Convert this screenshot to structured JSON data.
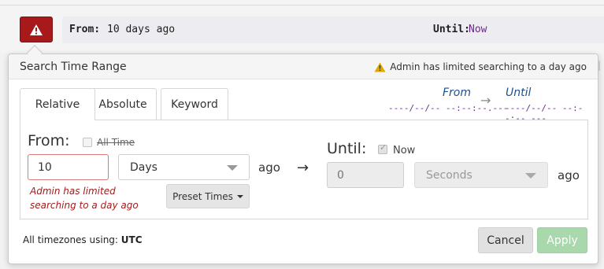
{
  "summary": {
    "from_label": "From:",
    "from_value": "10 days ago",
    "until_label": "Until:",
    "until_value": "Now",
    "warning_icon": "warning-triangle-icon"
  },
  "popover": {
    "title": "Search Time Range",
    "admin_warning": "Admin has limited searching to a day ago",
    "tabs": [
      {
        "label": "Relative",
        "active": true
      },
      {
        "label": "Absolute",
        "active": false
      },
      {
        "label": "Keyword",
        "active": false
      }
    ],
    "preview": {
      "from_label": "From",
      "until_label": "Until",
      "from_value": "----/--/-- --:--:--.---",
      "until_value": "----/--/-- --:--:--.---"
    },
    "from": {
      "label": "From:",
      "all_time_label": "All Time",
      "all_time_checked": false,
      "amount": "10",
      "unit": "Days",
      "ago": "ago",
      "error": "Admin has limited searching to a day ago",
      "preset_label": "Preset Times"
    },
    "until": {
      "label": "Until:",
      "now_label": "Now",
      "now_checked": true,
      "amount_placeholder": "0",
      "unit": "Seconds",
      "ago": "ago"
    },
    "footer": {
      "timezone_prefix": "All timezones using:",
      "timezone": "UTC",
      "cancel_label": "Cancel",
      "apply_label": "Apply"
    }
  },
  "colors": {
    "warning_button": "#a8191b",
    "error_text": "#a31b1b",
    "preview_label": "#1f4e8c",
    "preview_value": "#6b2a86",
    "apply_disabled": "#a9d8ad"
  }
}
